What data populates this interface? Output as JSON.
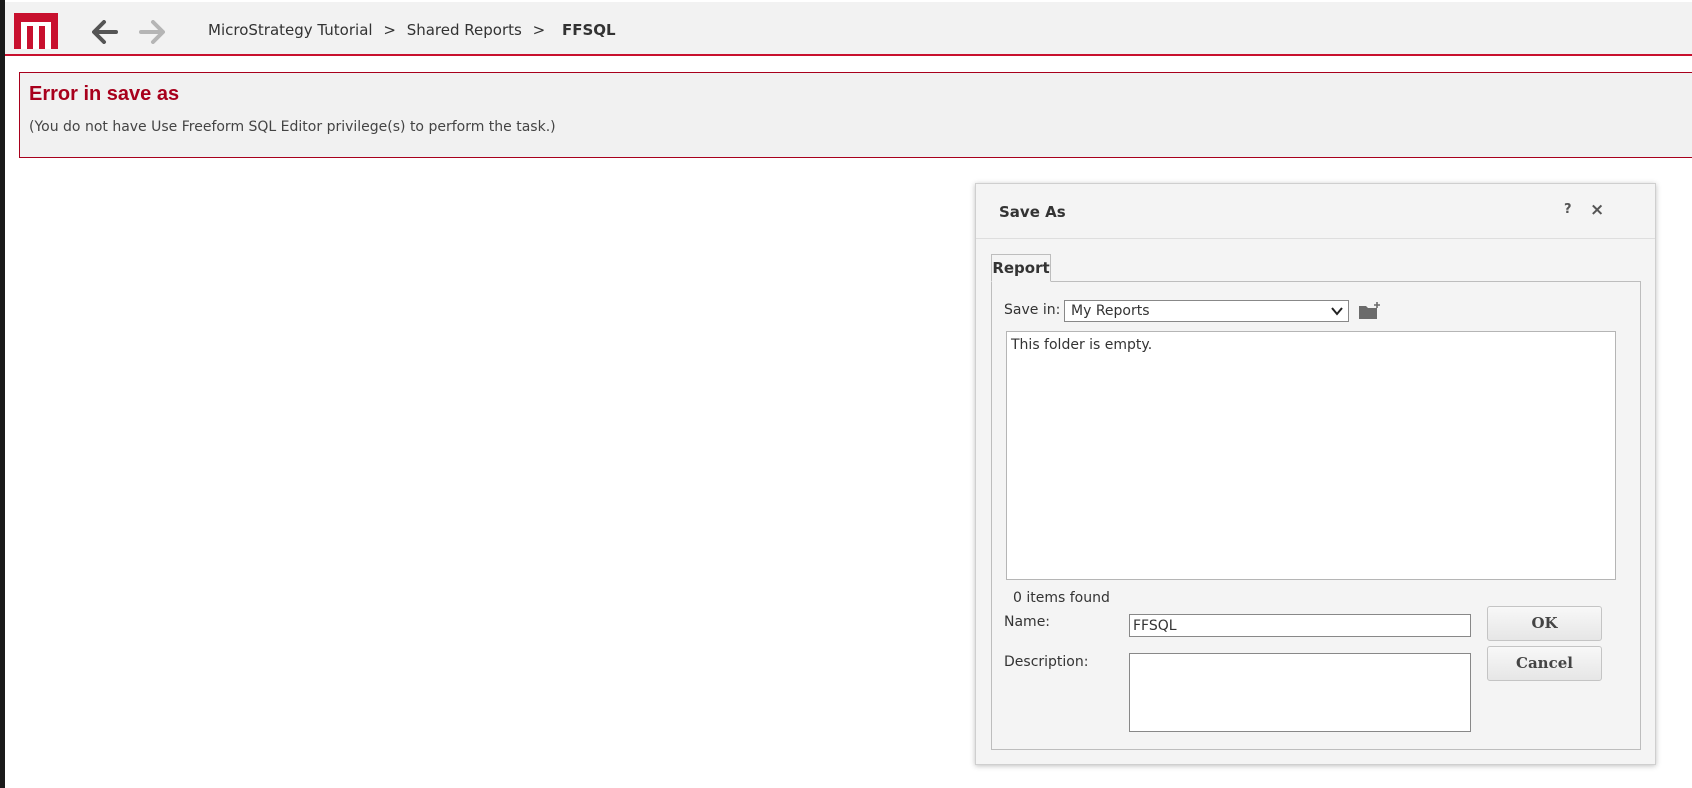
{
  "brand": {
    "logo_color": "#c8102e",
    "accent_color": "#a8001c"
  },
  "nav": {
    "back_icon": "arrow-left-icon",
    "forward_icon": "arrow-right-icon"
  },
  "breadcrumb": {
    "items": [
      "MicroStrategy Tutorial",
      "Shared Reports"
    ],
    "separator": ">",
    "current": "FFSQL"
  },
  "error": {
    "title": "Error in save as",
    "message": "(You do not have Use Freeform SQL Editor privilege(s) to perform the task.)"
  },
  "dialog": {
    "title": "Save As",
    "help_label": "?",
    "close_label": "×",
    "tab_label": "Report",
    "save_in_label": "Save in:",
    "save_in_value": "My Reports",
    "empty_message": "This folder is empty.",
    "items_found": "0 items found",
    "name_label": "Name:",
    "name_value": "FFSQL",
    "description_label": "Description:",
    "description_value": "",
    "ok_label": "OK",
    "cancel_label": "Cancel"
  }
}
